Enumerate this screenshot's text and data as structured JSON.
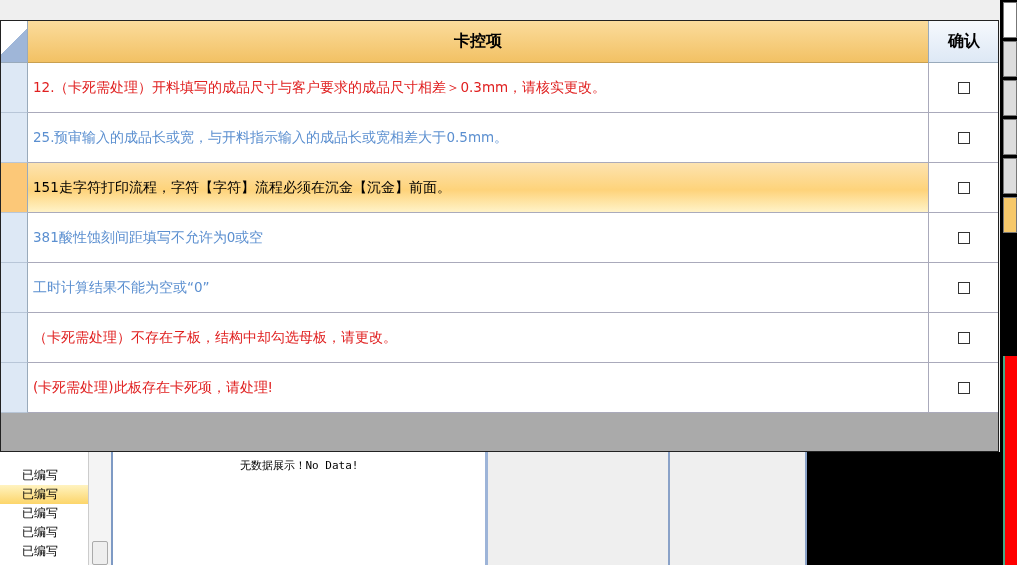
{
  "dialog": {
    "columns": [
      {
        "label": "卡控项"
      },
      {
        "label": "确认"
      }
    ],
    "rows": [
      {
        "text": "12.（卡死需处理）开料填写的成品尺寸与客户要求的成品尺寸相差＞0.3mm，请核实更改。",
        "color": "#e02020",
        "selected": false,
        "checked": false
      },
      {
        "text": "25.预审输入的成品长或宽，与开料指示输入的成品长或宽相差大于0.5mm。",
        "color": "#5b8fd0",
        "selected": false,
        "checked": false
      },
      {
        "text": "151走字符打印流程，字符【字符】流程必须在沉金【沉金】前面。",
        "color": "#000000",
        "selected": true,
        "checked": false
      },
      {
        "text": "381酸性蚀刻间距填写不允许为0或空",
        "color": "#5b8fd0",
        "selected": false,
        "checked": false
      },
      {
        "text": "工时计算结果不能为空或“0”",
        "color": "#5b8fd0",
        "selected": false,
        "checked": false
      },
      {
        "text": "（卡死需处理）不存在子板，结构中却勾选母板，请更改。",
        "color": "#e02020",
        "selected": false,
        "checked": false
      },
      {
        "text": "(卡死需处理)此板存在卡死项，请处理!",
        "color": "#e02020",
        "selected": false,
        "checked": false
      }
    ]
  },
  "background": {
    "status_list": [
      {
        "label": "已编写",
        "selected": false
      },
      {
        "label": "已编写",
        "selected": true
      },
      {
        "label": "已编写",
        "selected": false
      },
      {
        "label": "已编写",
        "selected": false
      },
      {
        "label": "已编写",
        "selected": false
      }
    ],
    "empty_message": "无数据展示！No Data!"
  }
}
